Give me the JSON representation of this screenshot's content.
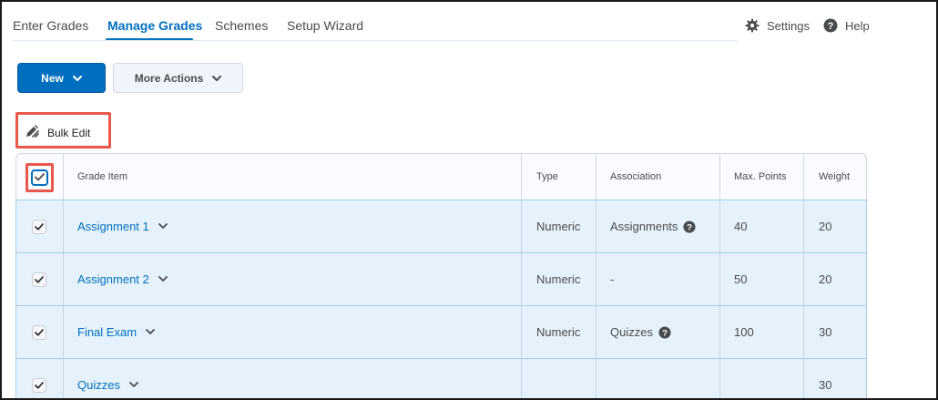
{
  "nav": {
    "tabs": [
      {
        "label": "Enter Grades",
        "active": false
      },
      {
        "label": "Manage Grades",
        "active": true
      },
      {
        "label": "Schemes",
        "active": false
      },
      {
        "label": "Setup Wizard",
        "active": false
      }
    ],
    "settings_label": "Settings",
    "help_label": "Help"
  },
  "toolbar": {
    "new_label": "New",
    "more_actions_label": "More Actions",
    "bulk_edit_label": "Bulk Edit"
  },
  "table": {
    "headers": {
      "grade_item": "Grade Item",
      "type": "Type",
      "association": "Association",
      "max_points": "Max. Points",
      "weight": "Weight"
    },
    "header_checkbox_checked": true,
    "rows": [
      {
        "name": "Assignment 1",
        "type": "Numeric",
        "association": "Assignments",
        "association_help": true,
        "max_points": "40",
        "weight": "20",
        "checked": true
      },
      {
        "name": "Assignment 2",
        "type": "Numeric",
        "association": "-",
        "association_help": false,
        "max_points": "50",
        "weight": "20",
        "checked": true
      },
      {
        "name": "Final Exam",
        "type": "Numeric",
        "association": "Quizzes",
        "association_help": true,
        "max_points": "100",
        "weight": "30",
        "checked": true
      },
      {
        "name": "Quizzes",
        "type": "",
        "association": "",
        "association_help": false,
        "max_points": "",
        "weight": "30",
        "checked": true
      }
    ]
  },
  "colors": {
    "accent": "#006fbf",
    "highlight_outline": "#e8574a",
    "row_selected_bg": "#e6f2fb"
  },
  "icons": {
    "settings": "gear-icon",
    "help": "help-circle-icon",
    "dropdown": "chevron-down-icon",
    "bulk_edit": "pencil-edit-icon",
    "checkbox": "checkmark-icon"
  }
}
